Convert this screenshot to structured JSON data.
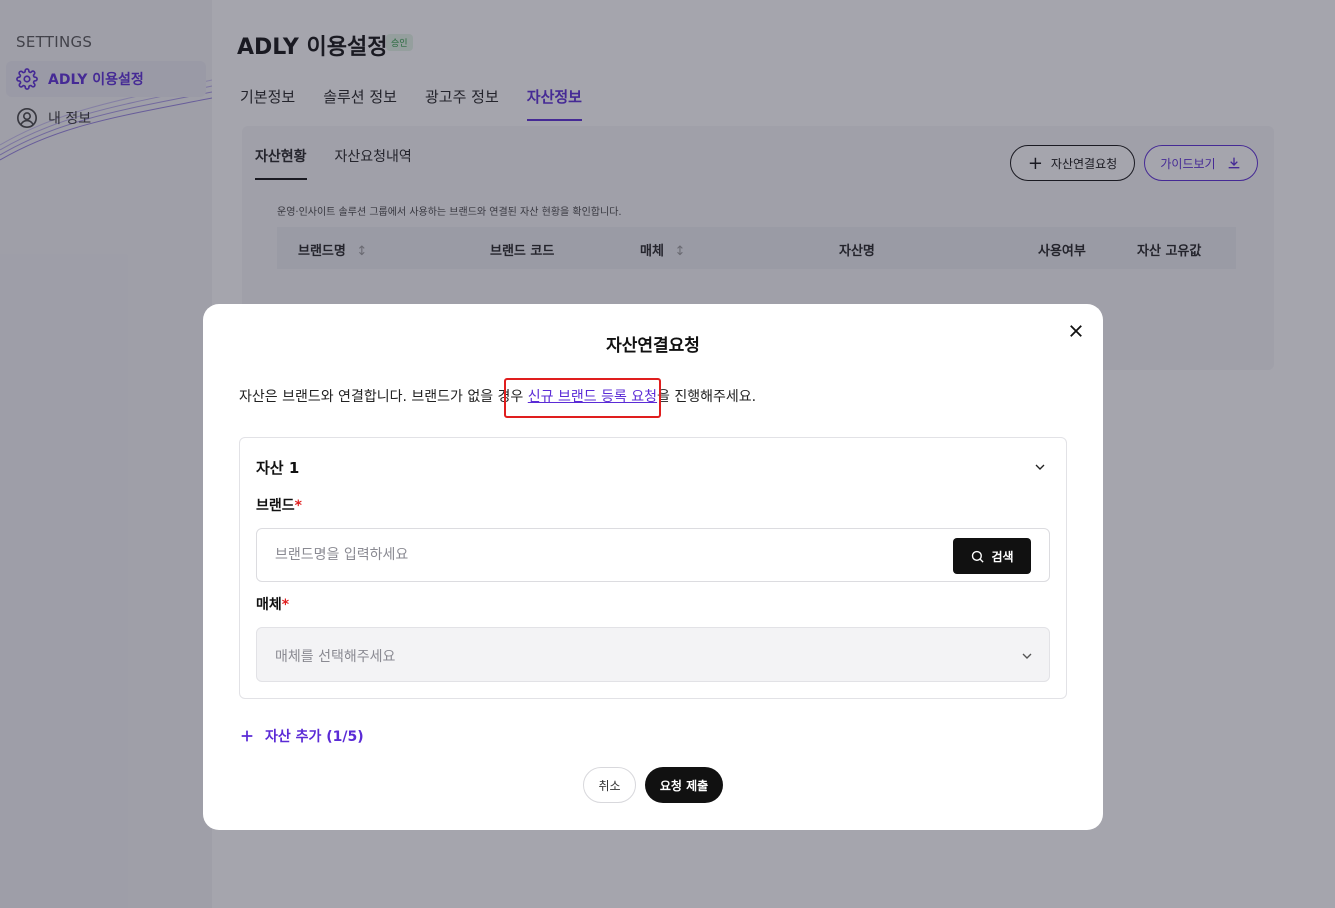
{
  "sidebar": {
    "title": "SETTINGS",
    "items": [
      {
        "label": "ADLY 이용설정",
        "icon": "gear-icon"
      },
      {
        "label": "내 정보",
        "icon": "user-circle-icon"
      }
    ]
  },
  "header": {
    "title": "ADLY 이용설정",
    "badge": "승인"
  },
  "tabs": [
    "기본정보",
    "솔루션 정보",
    "광고주 정보",
    "자산정보"
  ],
  "panel": {
    "subtabs": [
      "자산현황",
      "자산요청내역"
    ],
    "request_button": "자산연결요청",
    "guide_button": "가이드보기",
    "description": "운영·인사이트 솔루션 그룹에서 사용하는 브랜드와 연결된 자산 현황을 확인합니다.",
    "columns": [
      "브랜드명",
      "브랜드 코드",
      "매체",
      "자산명",
      "사용여부",
      "자산 고유값"
    ]
  },
  "modal": {
    "title": "자산연결요청",
    "intro_before": "자산은 브랜드와 연결합니다. 브랜드가 없을 경우 ",
    "intro_link": "신규 브랜드 등록 요청",
    "intro_after": "을 진행해주세요.",
    "asset_title": "자산 1",
    "brand_label": "브랜드",
    "brand_placeholder": "브랜드명을 입력하세요",
    "search_button": "검색",
    "media_label": "매체",
    "media_placeholder": "매체를 선택해주세요",
    "add_asset": "자산 추가 (1/5)",
    "cancel": "취소",
    "submit": "요청 제출"
  },
  "colors": {
    "accent": "#5b2bd6",
    "highlight_box": "#e01e1e",
    "required": "#e01e1e"
  }
}
